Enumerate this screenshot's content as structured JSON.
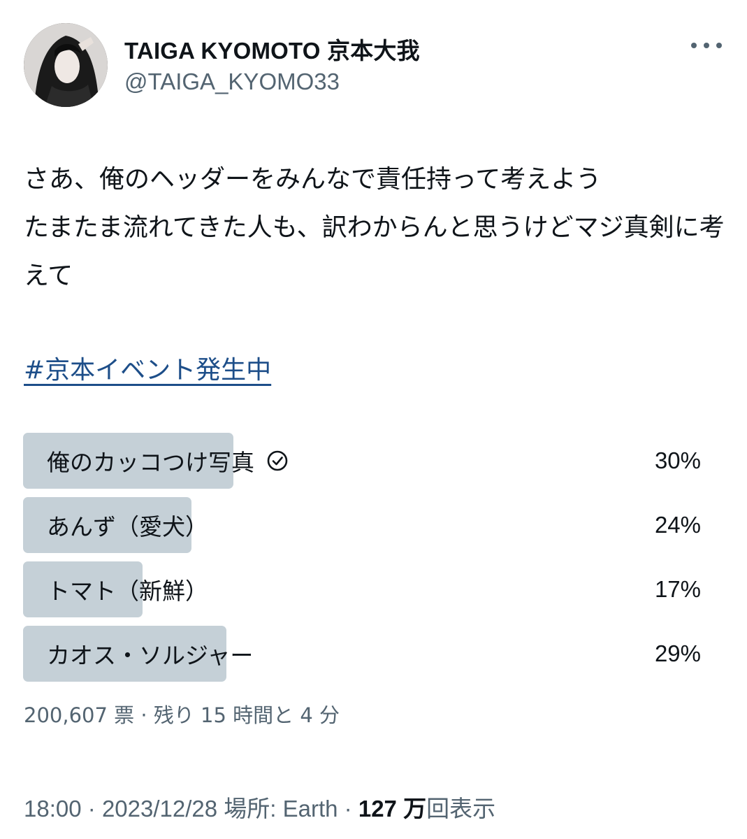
{
  "author": {
    "display_name": "TAIGA KYOMOTO 京本大我",
    "handle": "@TAIGA_KYOMO33"
  },
  "more_icon": "ellipsis-icon",
  "tweet": {
    "text": "さあ、俺のヘッダーをみんなで責任持って考えよう\nたまたま流れてきた人も、訳わからんと思うけどマジ真剣に考えて",
    "hashtag": "#京本イベント発生中"
  },
  "poll": {
    "options": [
      {
        "label": "俺のカッコつけ写真",
        "percent": "30%",
        "fraction": 0.3,
        "selected": true
      },
      {
        "label": "あんず（愛犬）",
        "percent": "24%",
        "fraction": 0.24,
        "selected": false
      },
      {
        "label": "トマト（新鮮）",
        "percent": "17%",
        "fraction": 0.17,
        "selected": false
      },
      {
        "label": "カオス・ソルジャー",
        "percent": "29%",
        "fraction": 0.29,
        "selected": false
      }
    ],
    "votes": "200,607 票",
    "remaining": "残り 15 時間と 4 分",
    "separator": "·"
  },
  "meta": {
    "time": "18:00",
    "date": "2023/12/28",
    "location": "場所: Earth",
    "views_count": "127 万",
    "views_label": "回表示",
    "separator": "·"
  },
  "colors": {
    "poll_fill": "#c5d0d7",
    "hashtag": "#1d4e89",
    "secondary_text": "#536471"
  }
}
